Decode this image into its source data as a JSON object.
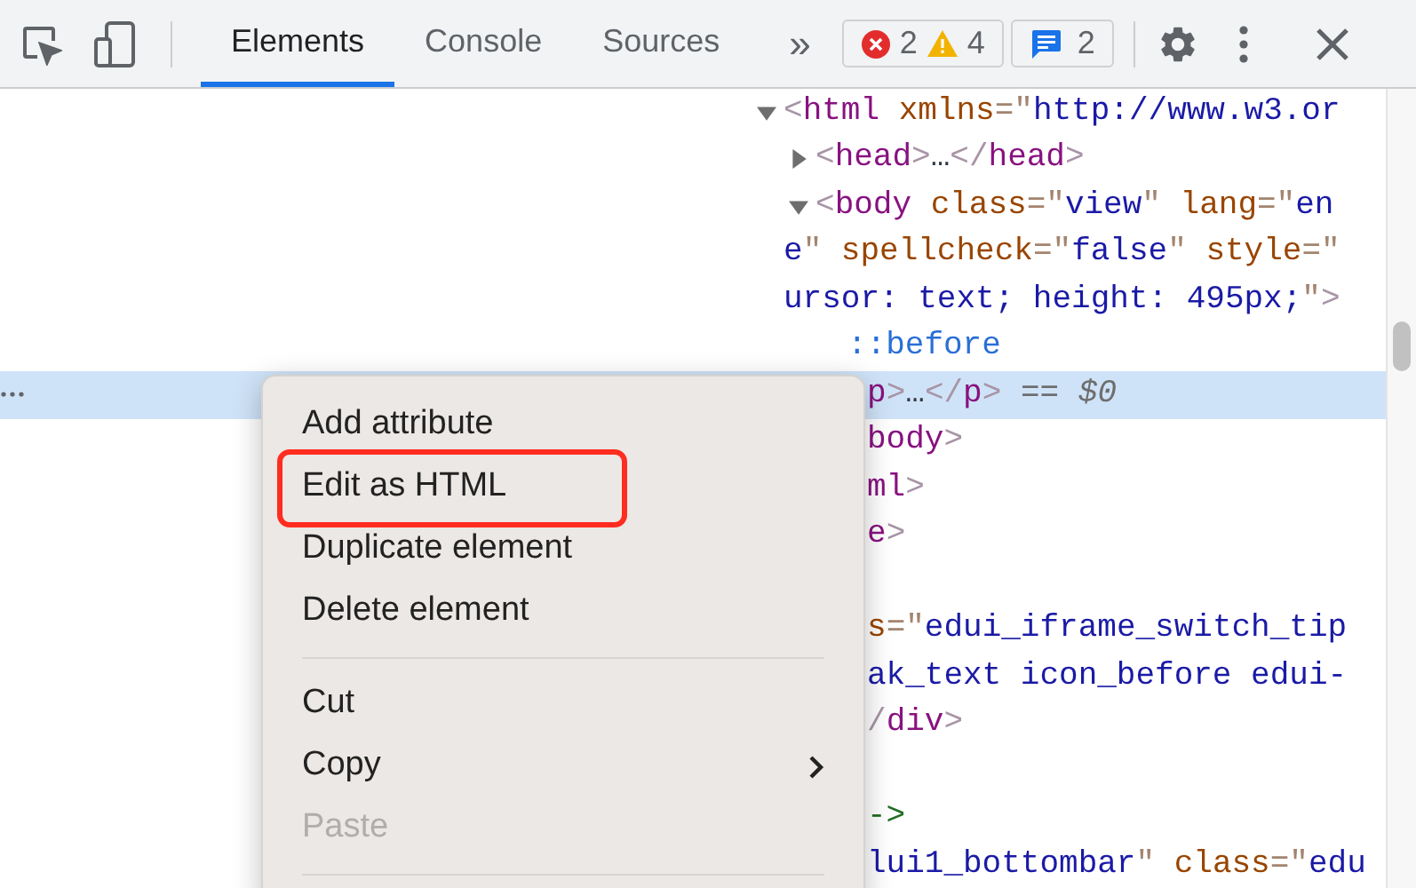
{
  "toolbar": {
    "tabs": [
      {
        "label": "Elements",
        "selected": true
      },
      {
        "label": "Console",
        "selected": false
      },
      {
        "label": "Sources",
        "selected": false
      }
    ],
    "more_tabs": "»",
    "counters": [
      {
        "kind": "error",
        "count": "2"
      },
      {
        "kind": "warning",
        "count": "4"
      },
      {
        "kind": "message",
        "count": "2"
      }
    ]
  },
  "dom_tree": {
    "nodes": [
      {
        "expanded": true,
        "lines": [
          [
            {
              "kind": "bracket",
              "text": "<"
            },
            {
              "kind": "tag",
              "text": "html"
            },
            {
              "kind": "attr",
              "text": " xmlns"
            },
            {
              "kind": "punct",
              "text": "=\""
            },
            {
              "kind": "value",
              "text": "http://www.w3.or"
            }
          ]
        ],
        "children": [
          {
            "expanded": false,
            "lines": [
              [
                {
                  "kind": "bracket",
                  "text": "<"
                },
                {
                  "kind": "tag",
                  "text": "head"
                },
                {
                  "kind": "bracket",
                  "text": ">"
                },
                {
                  "kind": "plain",
                  "text": "…"
                },
                {
                  "kind": "bracket",
                  "text": "</"
                },
                {
                  "kind": "tag",
                  "text": "head"
                },
                {
                  "kind": "bracket",
                  "text": ">"
                }
              ]
            ]
          },
          {
            "expanded": true,
            "lines": [
              [
                {
                  "kind": "bracket",
                  "text": "<"
                },
                {
                  "kind": "tag",
                  "text": "body"
                },
                {
                  "kind": "attr",
                  "text": " class"
                },
                {
                  "kind": "punct",
                  "text": "=\""
                },
                {
                  "kind": "value",
                  "text": "view"
                },
                {
                  "kind": "punct",
                  "text": "\""
                },
                {
                  "kind": "attr",
                  "text": " lang"
                },
                {
                  "kind": "punct",
                  "text": "=\""
                },
                {
                  "kind": "value",
                  "text": "en"
                }
              ],
              [
                {
                  "kind": "value",
                  "text": "e"
                },
                {
                  "kind": "punct",
                  "text": "\""
                },
                {
                  "kind": "attr",
                  "text": " spellcheck"
                },
                {
                  "kind": "punct",
                  "text": "=\""
                },
                {
                  "kind": "value",
                  "text": "false"
                },
                {
                  "kind": "punct",
                  "text": "\""
                },
                {
                  "kind": "attr",
                  "text": " style"
                },
                {
                  "kind": "punct",
                  "text": "=\""
                }
              ],
              [
                {
                  "kind": "value",
                  "text": "ursor: text; height: 495px;"
                },
                {
                  "kind": "punct",
                  "text": "\""
                },
                {
                  "kind": "bracket",
                  "text": ">"
                }
              ]
            ],
            "children": [
              {
                "lines": [
                  [
                    {
                      "kind": "pseudo",
                      "text": "::before"
                    }
                  ]
                ]
              }
            ]
          }
        ]
      }
    ],
    "rows_beside_menu": [
      {
        "kind": "code",
        "selected": true,
        "segments": [
          {
            "kind": "tag",
            "text": "p"
          },
          {
            "kind": "bracket",
            "text": ">"
          },
          {
            "kind": "plain",
            "text": "…"
          },
          {
            "kind": "bracket",
            "text": "</"
          },
          {
            "kind": "tag",
            "text": "p"
          },
          {
            "kind": "bracket",
            "text": ">"
          },
          {
            "kind": "note",
            "text": " == "
          },
          {
            "kind": "dollar",
            "text": "$0"
          }
        ]
      },
      {
        "kind": "code",
        "selected": false,
        "segments": [
          {
            "kind": "tag",
            "text": "body"
          },
          {
            "kind": "bracket",
            "text": ">"
          }
        ]
      },
      {
        "kind": "code",
        "selected": false,
        "segments": [
          {
            "kind": "tag",
            "text": "ml"
          },
          {
            "kind": "bracket",
            "text": ">"
          }
        ]
      },
      {
        "kind": "code",
        "selected": false,
        "segments": [
          {
            "kind": "tag",
            "text": "e"
          },
          {
            "kind": "bracket",
            "text": ">"
          }
        ]
      },
      {
        "kind": "covered",
        "selected": false
      },
      {
        "kind": "code",
        "selected": false,
        "segments": [
          {
            "kind": "attr",
            "text": "s"
          },
          {
            "kind": "punct",
            "text": "=\""
          },
          {
            "kind": "value",
            "text": "edui_iframe_switch_tip"
          }
        ]
      },
      {
        "kind": "code",
        "selected": false,
        "segments": [
          {
            "kind": "value",
            "text": "ak_text icon_before edui-"
          }
        ]
      },
      {
        "kind": "code",
        "selected": false,
        "segments": [
          {
            "kind": "bracket",
            "text": "/"
          },
          {
            "kind": "tag",
            "text": "div"
          },
          {
            "kind": "bracket",
            "text": ">"
          }
        ]
      },
      {
        "kind": "covered",
        "selected": false
      },
      {
        "kind": "code",
        "selected": false,
        "segments": [
          {
            "kind": "comment",
            "text": "->"
          }
        ]
      },
      {
        "kind": "code",
        "selected": false,
        "segments": [
          {
            "kind": "value",
            "text": "lui1_bottombar"
          },
          {
            "kind": "punct",
            "text": "\""
          },
          {
            "kind": "attr",
            "text": " class"
          },
          {
            "kind": "punct",
            "text": "=\""
          },
          {
            "kind": "value",
            "text": "edu"
          }
        ]
      }
    ]
  },
  "context_menu": {
    "items": [
      {
        "kind": "item",
        "label": "Add attribute",
        "disabled": false
      },
      {
        "kind": "item",
        "label": "Edit as HTML",
        "disabled": false,
        "annotated": true
      },
      {
        "kind": "item",
        "label": "Duplicate element",
        "disabled": false
      },
      {
        "kind": "item",
        "label": "Delete element",
        "disabled": false
      },
      {
        "kind": "separator"
      },
      {
        "kind": "item",
        "label": "Cut",
        "disabled": false
      },
      {
        "kind": "item",
        "label": "Copy",
        "disabled": false,
        "submenu": true
      },
      {
        "kind": "item",
        "label": "Paste",
        "disabled": true
      },
      {
        "kind": "separator"
      }
    ]
  }
}
